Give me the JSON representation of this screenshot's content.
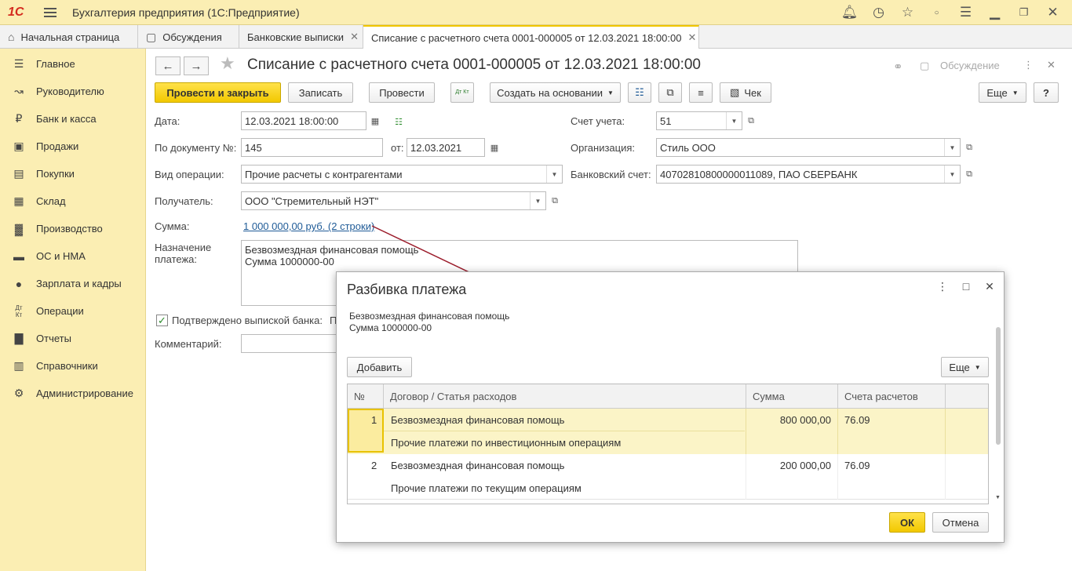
{
  "app": {
    "logo": "1С",
    "title": "Бухгалтерия предприятия (1С:Предприятие)"
  },
  "titlebar_icons": [
    "bell-icon",
    "history-icon",
    "star-icon",
    "circle-icon",
    "menu-settings-icon",
    "minimize-icon",
    "restore-icon",
    "close-icon"
  ],
  "tabs": [
    {
      "label": "Начальная страница",
      "icon": "home-icon"
    },
    {
      "label": "Обсуждения",
      "icon": "chat-icon"
    },
    {
      "label": "Банковские выписки",
      "closable": true
    },
    {
      "label": "Списание с расчетного счета 0001-000005 от 12.03.2021 18:00:00",
      "closable": true,
      "active": true
    }
  ],
  "sidebar": {
    "items": [
      {
        "label": "Главное",
        "icon": "list-icon"
      },
      {
        "label": "Руководителю",
        "icon": "trend-icon"
      },
      {
        "label": "Банк и касса",
        "icon": "ruble-icon"
      },
      {
        "label": "Продажи",
        "icon": "bag-icon"
      },
      {
        "label": "Покупки",
        "icon": "cart-icon"
      },
      {
        "label": "Склад",
        "icon": "warehouse-icon"
      },
      {
        "label": "Производство",
        "icon": "factory-icon"
      },
      {
        "label": "ОС и НМА",
        "icon": "truck-icon"
      },
      {
        "label": "Зарплата и кадры",
        "icon": "person-icon"
      },
      {
        "label": "Операции",
        "icon": "dtkt-icon"
      },
      {
        "label": "Отчеты",
        "icon": "barchart-icon"
      },
      {
        "label": "Справочники",
        "icon": "book-icon"
      },
      {
        "label": "Администрирование",
        "icon": "gear-icon"
      }
    ]
  },
  "document": {
    "title": "Списание с расчетного счета 0001-000005 от 12.03.2021 18:00:00",
    "discussion": "Обсуждение",
    "toolbar": {
      "post_and_close": "Провести и закрыть",
      "save": "Записать",
      "post": "Провести",
      "dtkt": "Дт Кт",
      "create_based": "Создать на основании",
      "receipt": "Чек",
      "more": "Еще",
      "help": "?"
    },
    "fields": {
      "date_label": "Дата:",
      "date_value": "12.03.2021 18:00:00",
      "docnum_label": "По документу №:",
      "docnum_value": "145",
      "from_label": "от:",
      "from_value": "12.03.2021",
      "optype_label": "Вид операции:",
      "optype_value": "Прочие расчеты с контрагентами",
      "recipient_label": "Получатель:",
      "recipient_value": "ООО \"Стремительный НЭТ\"",
      "sum_label": "Сумма:",
      "sum_value": "1 000 000,00 руб. (2 строки)",
      "purpose_label_1": "Назначение",
      "purpose_label_2": "платежа:",
      "purpose_line1": "Безвозмездная финансовая помощь",
      "purpose_line2": "Сумма 1000000-00",
      "confirmed_label": "Подтверждено выпиской банка:",
      "confirmed_value": "П",
      "comment_label": "Комментарий:",
      "account_label": "Счет учета:",
      "account_value": "51",
      "org_label": "Организация:",
      "org_value": "Стиль ООО",
      "bank_label": "Банковский счет:",
      "bank_value": "40702810800000011089, ПАО СБЕРБАНК"
    }
  },
  "dialog": {
    "title": "Разбивка платежа",
    "text_line1": "Безвозмездная финансовая помощь",
    "text_line2": "Сумма 1000000-00",
    "add_button": "Добавить",
    "more_button": "Еще",
    "ok": "ОК",
    "cancel": "Отмена",
    "columns": [
      "№",
      "Договор / Статья расходов",
      "Сумма",
      "Счета расчетов"
    ],
    "rows": [
      {
        "num": "1",
        "contract": "Безвозмездная финансовая помощь",
        "article": "Прочие платежи по инвестиционным операциям",
        "sum": "800 000,00",
        "account": "76.09",
        "selected": true
      },
      {
        "num": "2",
        "contract": "Безвозмездная финансовая помощь",
        "article": "Прочие платежи по текущим операциям",
        "sum": "200 000,00",
        "account": "76.09",
        "selected": false
      }
    ]
  },
  "colors": {
    "sidebar_bg": "#fbeeb3",
    "primary_button": "#f2c800",
    "link": "#1f5b97",
    "arrow": "#9b1b2a",
    "selected_row": "#fbf4c7"
  }
}
